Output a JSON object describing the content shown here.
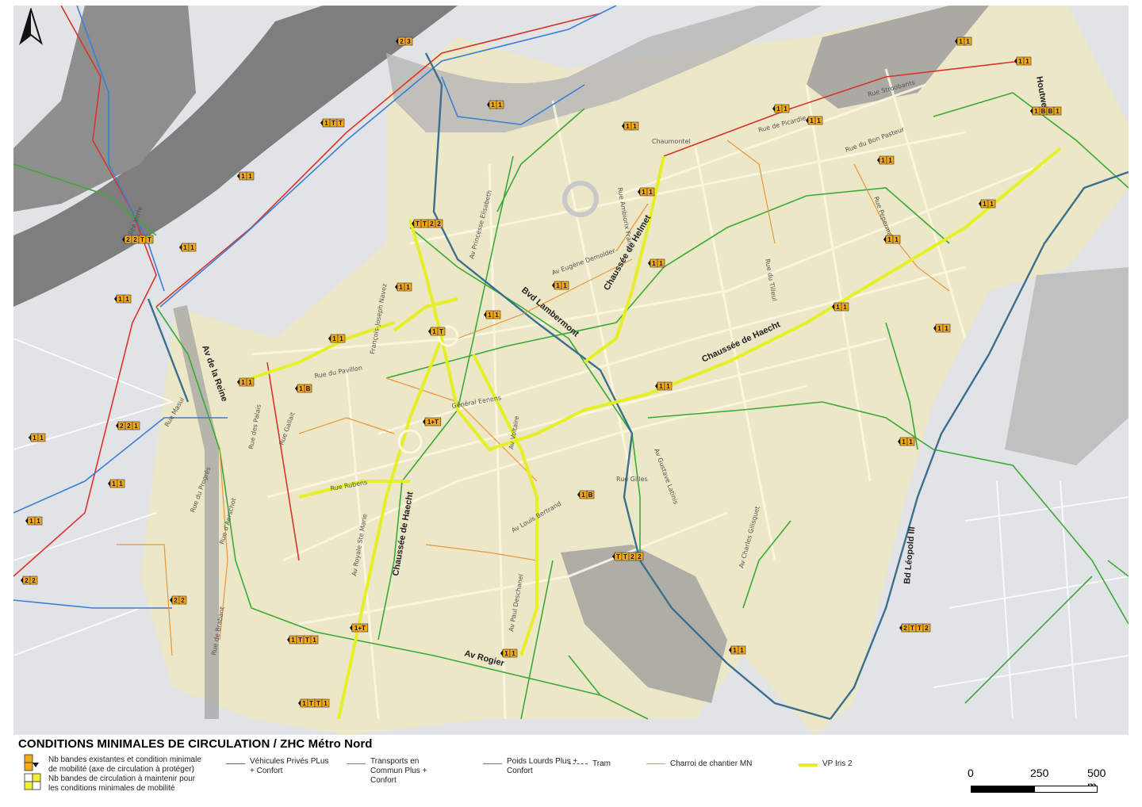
{
  "map": {
    "title": "CONDITIONS MINIMALES DE CIRCULATION / ZHC Métro Nord",
    "major_streets": [
      {
        "label": "Bvd Lambermont"
      },
      {
        "label": "Chaussée de Helmet"
      },
      {
        "label": "Chaussée de Haecht"
      },
      {
        "label": "Chaussée de Haecht"
      },
      {
        "label": "Av de la Reine"
      },
      {
        "label": "Av Rogier"
      },
      {
        "label": "Bd Léopold III"
      },
      {
        "label": "Houtweg"
      }
    ],
    "minor_streets": [
      {
        "label": "Rue du Pavillon"
      },
      {
        "label": "Rue Rubens"
      },
      {
        "label": "Av Royale Ste Marie"
      },
      {
        "label": "Av Paul Deschanel"
      },
      {
        "label": "Av Louis Bertrand"
      },
      {
        "label": "Général Eenens"
      },
      {
        "label": "Av Voltaire"
      },
      {
        "label": "Rue Gallait"
      },
      {
        "label": "Rue Masui"
      },
      {
        "label": "Rue du Progrès"
      },
      {
        "label": "Rue d'Aerschot"
      },
      {
        "label": "Rue de Brabant"
      },
      {
        "label": "Rue des Palais"
      },
      {
        "label": "Av Princesse Elisabeth"
      },
      {
        "label": "Av Eugène Demolder"
      },
      {
        "label": "Rue Ambiorix France"
      },
      {
        "label": "Chaumontel"
      },
      {
        "label": "Rue de Picardie"
      },
      {
        "label": "Rue Stroobants"
      },
      {
        "label": "Rue du Bon Pasteur"
      },
      {
        "label": "Rue du Tilleul"
      },
      {
        "label": "Rue Peperman"
      },
      {
        "label": "Av Charles Gilisquet"
      },
      {
        "label": "Av Gustave Latinis"
      },
      {
        "label": "François-Joseph Navez"
      },
      {
        "label": "Rue Gilles"
      },
      {
        "label": "Allée Verte"
      }
    ],
    "badges": [
      {
        "t": "1 1"
      },
      {
        "t": "2 2 T T"
      },
      {
        "t": "1 1"
      },
      {
        "t": "1 1"
      },
      {
        "t": "1 1"
      },
      {
        "t": "1 T T"
      },
      {
        "t": "1 1"
      },
      {
        "t": "2 3"
      },
      {
        "t": "1 1"
      },
      {
        "t": "1 1"
      },
      {
        "t": "T T 2 2"
      },
      {
        "t": "1 1"
      },
      {
        "t": "1 T"
      },
      {
        "t": "1 1"
      },
      {
        "t": "1 1"
      },
      {
        "t": "1 B"
      },
      {
        "t": "1 1"
      },
      {
        "t": "1 1"
      },
      {
        "t": "1+T"
      },
      {
        "t": "1 1"
      },
      {
        "t": "T T 2 2"
      },
      {
        "t": "1 1"
      },
      {
        "t": "1 1"
      },
      {
        "t": "1 1"
      },
      {
        "t": "1 1"
      },
      {
        "t": "1 B"
      },
      {
        "t": "1 1"
      },
      {
        "t": "1 B B 1"
      },
      {
        "t": "1 1"
      },
      {
        "t": "1 1"
      },
      {
        "t": "1 1"
      },
      {
        "t": "1 1"
      },
      {
        "t": "1 1"
      },
      {
        "t": "2 T T 2"
      },
      {
        "t": "1 1"
      },
      {
        "t": "1+T"
      },
      {
        "t": "1 T T 1"
      },
      {
        "t": "1 T T 1"
      },
      {
        "t": "1 1"
      },
      {
        "t": "2 2"
      },
      {
        "t": "2 2 1"
      },
      {
        "t": "1 1"
      },
      {
        "t": "1 1"
      },
      {
        "t": "1 1"
      },
      {
        "t": "2 2"
      }
    ]
  },
  "legend": {
    "title": "CONDITIONS MINIMALES DE CIRCULATION / ZHC Métro Nord",
    "symbol_text_1": "Nb bandes existantes et condition minimale de mobilité (axe de circulation à protéger)",
    "symbol_text_2": "Nb bandes de circulation à maintenir pour les conditions minimales de mobilité",
    "items": [
      {
        "label": "Véhicules Privés PLus + Confort",
        "color": "#d9342b"
      },
      {
        "label": "Transports en Commun Plus + Confort",
        "color": "#3aaa35"
      },
      {
        "label": "Poids Lourds Plus + Confort",
        "color": "#3a7fd5"
      },
      {
        "label": "Tram",
        "color": "#555555"
      },
      {
        "label": "Charroi de chantier MN",
        "color": "#e8963c"
      },
      {
        "label": "VP Iris 2",
        "color": "#e6f01e"
      }
    ],
    "scale": {
      "l0": "0",
      "l1": "250",
      "l2": "500 m"
    }
  },
  "colors": {
    "zone": "#ebe7c3",
    "water": "#7d7d7d",
    "rail": "#a8a8a8",
    "badge": "#f3a91d"
  }
}
